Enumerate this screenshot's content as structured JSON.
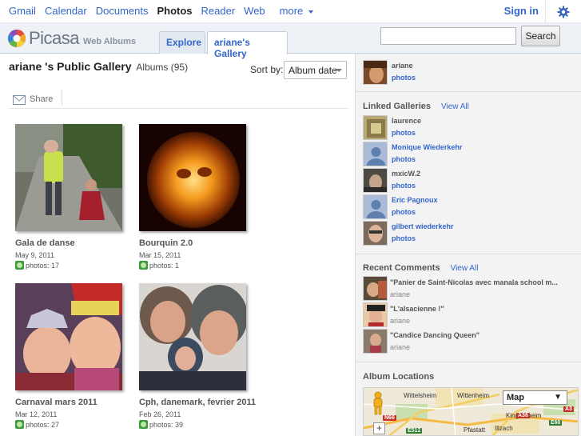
{
  "gbar": {
    "links": [
      "Gmail",
      "Calendar",
      "Documents",
      "Photos",
      "Reader",
      "Web",
      "more"
    ],
    "active": "Photos",
    "signin": "Sign in"
  },
  "header": {
    "logo": "Picasa",
    "logo_sub": "Web Albums",
    "tab_explore": "Explore",
    "tab_gallery": "ariane's Gallery",
    "search_value": "",
    "search_button": "Search"
  },
  "main": {
    "title": "ariane 's Public Gallery",
    "albums_count": "Albums (95)",
    "sort_label": "Sort by:",
    "sort_value": "Album date",
    "share_label": "Share",
    "albums": [
      {
        "name": "Gala de danse",
        "date": "May 9, 2011",
        "count": "photos: 17"
      },
      {
        "name": "Bourquin 2.0",
        "date": "Mar 15, 2011",
        "count": "photos: 1"
      },
      {
        "name": "Carnaval mars 2011",
        "date": "Mar 12, 2011",
        "count": "photos: 27"
      },
      {
        "name": "Cph, danemark, fevrier 2011",
        "date": "Feb 26, 2011",
        "count": "photos: 39"
      }
    ]
  },
  "sidebar": {
    "owner": {
      "name": "ariane",
      "photos": "photos"
    },
    "linked_title": "Linked Galleries",
    "linked_view_all": "View All",
    "linked": [
      {
        "name": "laurence",
        "photos": "photos"
      },
      {
        "name": "Monique Wiederkehr",
        "photos": "photos"
      },
      {
        "name": "mxicW.2",
        "photos": "photos"
      },
      {
        "name": "Eric Pagnoux",
        "photos": "photos"
      },
      {
        "name": "gilbert wiederkehr",
        "photos": "photos"
      }
    ],
    "comments_title": "Recent Comments",
    "comments_view_all": "View All",
    "comments": [
      {
        "text": "\"Panier de Saint-Nicolas avec manala school m...",
        "user": "ariane"
      },
      {
        "text": "\"L'alsacienne !\"",
        "user": "ariane"
      },
      {
        "text": "\"Candice Dancing Queen\"",
        "user": "ariane"
      }
    ],
    "locations_title": "Album Locations",
    "map": {
      "type_label": "Map",
      "labels": [
        "Wittelsheim",
        "Wittenheim",
        "Kingersheim",
        "Pfastatt",
        "Illzach"
      ],
      "roads": [
        "N66",
        "E512",
        "A36",
        "E60",
        "A3"
      ],
      "zoom": "+"
    }
  }
}
